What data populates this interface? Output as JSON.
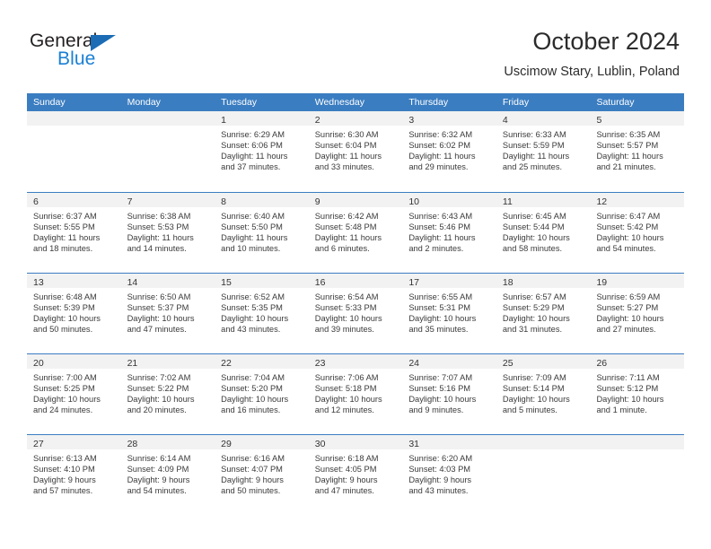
{
  "brand": {
    "name_part1": "General",
    "name_part2": "Blue",
    "accent_color": "#1b7fd4",
    "triangle_color": "#1b6cb5"
  },
  "header": {
    "title": "October 2024",
    "subtitle": "Uscimow Stary, Lublin, Poland"
  },
  "calendar": {
    "header_color": "#3b7dc1",
    "day_band_color": "#f2f2f2",
    "weekdays": [
      "Sunday",
      "Monday",
      "Tuesday",
      "Wednesday",
      "Thursday",
      "Friday",
      "Saturday"
    ],
    "weeks": [
      [
        {
          "day": "",
          "empty": true
        },
        {
          "day": "",
          "empty": true
        },
        {
          "day": "1",
          "sunrise": "Sunrise: 6:29 AM",
          "sunset": "Sunset: 6:06 PM",
          "daylight1": "Daylight: 11 hours",
          "daylight2": "and 37 minutes."
        },
        {
          "day": "2",
          "sunrise": "Sunrise: 6:30 AM",
          "sunset": "Sunset: 6:04 PM",
          "daylight1": "Daylight: 11 hours",
          "daylight2": "and 33 minutes."
        },
        {
          "day": "3",
          "sunrise": "Sunrise: 6:32 AM",
          "sunset": "Sunset: 6:02 PM",
          "daylight1": "Daylight: 11 hours",
          "daylight2": "and 29 minutes."
        },
        {
          "day": "4",
          "sunrise": "Sunrise: 6:33 AM",
          "sunset": "Sunset: 5:59 PM",
          "daylight1": "Daylight: 11 hours",
          "daylight2": "and 25 minutes."
        },
        {
          "day": "5",
          "sunrise": "Sunrise: 6:35 AM",
          "sunset": "Sunset: 5:57 PM",
          "daylight1": "Daylight: 11 hours",
          "daylight2": "and 21 minutes."
        }
      ],
      [
        {
          "day": "6",
          "sunrise": "Sunrise: 6:37 AM",
          "sunset": "Sunset: 5:55 PM",
          "daylight1": "Daylight: 11 hours",
          "daylight2": "and 18 minutes."
        },
        {
          "day": "7",
          "sunrise": "Sunrise: 6:38 AM",
          "sunset": "Sunset: 5:53 PM",
          "daylight1": "Daylight: 11 hours",
          "daylight2": "and 14 minutes."
        },
        {
          "day": "8",
          "sunrise": "Sunrise: 6:40 AM",
          "sunset": "Sunset: 5:50 PM",
          "daylight1": "Daylight: 11 hours",
          "daylight2": "and 10 minutes."
        },
        {
          "day": "9",
          "sunrise": "Sunrise: 6:42 AM",
          "sunset": "Sunset: 5:48 PM",
          "daylight1": "Daylight: 11 hours",
          "daylight2": "and 6 minutes."
        },
        {
          "day": "10",
          "sunrise": "Sunrise: 6:43 AM",
          "sunset": "Sunset: 5:46 PM",
          "daylight1": "Daylight: 11 hours",
          "daylight2": "and 2 minutes."
        },
        {
          "day": "11",
          "sunrise": "Sunrise: 6:45 AM",
          "sunset": "Sunset: 5:44 PM",
          "daylight1": "Daylight: 10 hours",
          "daylight2": "and 58 minutes."
        },
        {
          "day": "12",
          "sunrise": "Sunrise: 6:47 AM",
          "sunset": "Sunset: 5:42 PM",
          "daylight1": "Daylight: 10 hours",
          "daylight2": "and 54 minutes."
        }
      ],
      [
        {
          "day": "13",
          "sunrise": "Sunrise: 6:48 AM",
          "sunset": "Sunset: 5:39 PM",
          "daylight1": "Daylight: 10 hours",
          "daylight2": "and 50 minutes."
        },
        {
          "day": "14",
          "sunrise": "Sunrise: 6:50 AM",
          "sunset": "Sunset: 5:37 PM",
          "daylight1": "Daylight: 10 hours",
          "daylight2": "and 47 minutes."
        },
        {
          "day": "15",
          "sunrise": "Sunrise: 6:52 AM",
          "sunset": "Sunset: 5:35 PM",
          "daylight1": "Daylight: 10 hours",
          "daylight2": "and 43 minutes."
        },
        {
          "day": "16",
          "sunrise": "Sunrise: 6:54 AM",
          "sunset": "Sunset: 5:33 PM",
          "daylight1": "Daylight: 10 hours",
          "daylight2": "and 39 minutes."
        },
        {
          "day": "17",
          "sunrise": "Sunrise: 6:55 AM",
          "sunset": "Sunset: 5:31 PM",
          "daylight1": "Daylight: 10 hours",
          "daylight2": "and 35 minutes."
        },
        {
          "day": "18",
          "sunrise": "Sunrise: 6:57 AM",
          "sunset": "Sunset: 5:29 PM",
          "daylight1": "Daylight: 10 hours",
          "daylight2": "and 31 minutes."
        },
        {
          "day": "19",
          "sunrise": "Sunrise: 6:59 AM",
          "sunset": "Sunset: 5:27 PM",
          "daylight1": "Daylight: 10 hours",
          "daylight2": "and 27 minutes."
        }
      ],
      [
        {
          "day": "20",
          "sunrise": "Sunrise: 7:00 AM",
          "sunset": "Sunset: 5:25 PM",
          "daylight1": "Daylight: 10 hours",
          "daylight2": "and 24 minutes."
        },
        {
          "day": "21",
          "sunrise": "Sunrise: 7:02 AM",
          "sunset": "Sunset: 5:22 PM",
          "daylight1": "Daylight: 10 hours",
          "daylight2": "and 20 minutes."
        },
        {
          "day": "22",
          "sunrise": "Sunrise: 7:04 AM",
          "sunset": "Sunset: 5:20 PM",
          "daylight1": "Daylight: 10 hours",
          "daylight2": "and 16 minutes."
        },
        {
          "day": "23",
          "sunrise": "Sunrise: 7:06 AM",
          "sunset": "Sunset: 5:18 PM",
          "daylight1": "Daylight: 10 hours",
          "daylight2": "and 12 minutes."
        },
        {
          "day": "24",
          "sunrise": "Sunrise: 7:07 AM",
          "sunset": "Sunset: 5:16 PM",
          "daylight1": "Daylight: 10 hours",
          "daylight2": "and 9 minutes."
        },
        {
          "day": "25",
          "sunrise": "Sunrise: 7:09 AM",
          "sunset": "Sunset: 5:14 PM",
          "daylight1": "Daylight: 10 hours",
          "daylight2": "and 5 minutes."
        },
        {
          "day": "26",
          "sunrise": "Sunrise: 7:11 AM",
          "sunset": "Sunset: 5:12 PM",
          "daylight1": "Daylight: 10 hours",
          "daylight2": "and 1 minute."
        }
      ],
      [
        {
          "day": "27",
          "sunrise": "Sunrise: 6:13 AM",
          "sunset": "Sunset: 4:10 PM",
          "daylight1": "Daylight: 9 hours",
          "daylight2": "and 57 minutes."
        },
        {
          "day": "28",
          "sunrise": "Sunrise: 6:14 AM",
          "sunset": "Sunset: 4:09 PM",
          "daylight1": "Daylight: 9 hours",
          "daylight2": "and 54 minutes."
        },
        {
          "day": "29",
          "sunrise": "Sunrise: 6:16 AM",
          "sunset": "Sunset: 4:07 PM",
          "daylight1": "Daylight: 9 hours",
          "daylight2": "and 50 minutes."
        },
        {
          "day": "30",
          "sunrise": "Sunrise: 6:18 AM",
          "sunset": "Sunset: 4:05 PM",
          "daylight1": "Daylight: 9 hours",
          "daylight2": "and 47 minutes."
        },
        {
          "day": "31",
          "sunrise": "Sunrise: 6:20 AM",
          "sunset": "Sunset: 4:03 PM",
          "daylight1": "Daylight: 9 hours",
          "daylight2": "and 43 minutes."
        },
        {
          "day": "",
          "empty": true
        },
        {
          "day": "",
          "empty": true
        }
      ]
    ]
  }
}
